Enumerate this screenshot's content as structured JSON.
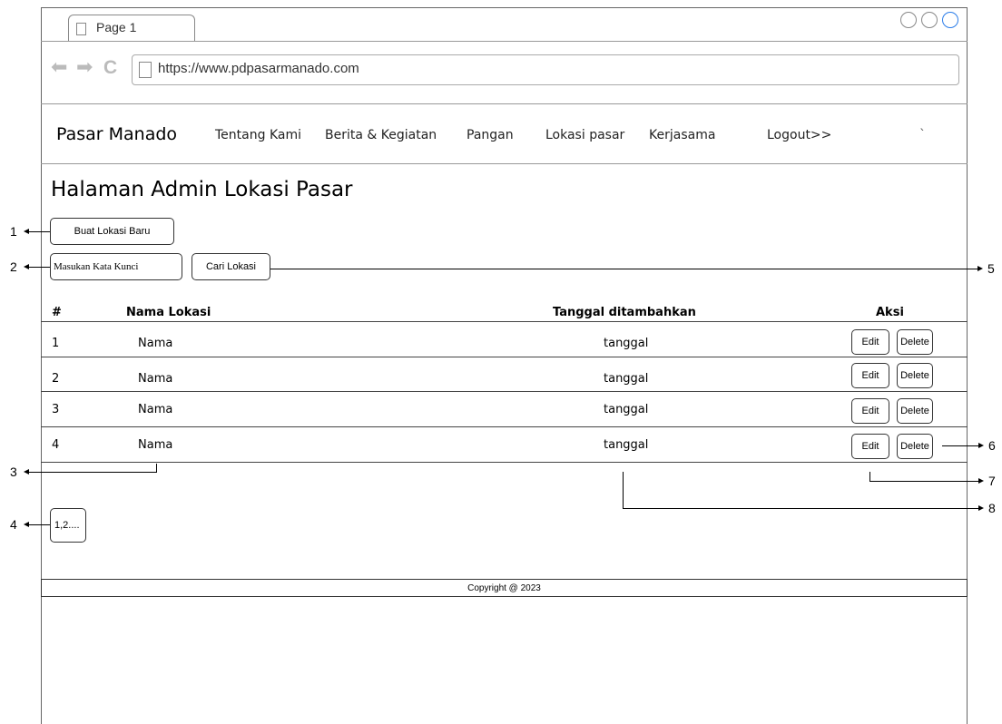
{
  "browser": {
    "tab_label": "Page 1",
    "url": "https://www.pdpasarmanado.com",
    "back_glyph": "⬅",
    "forward_glyph": "➡",
    "reload_glyph": "C"
  },
  "nav": {
    "brand": "Pasar Manado",
    "items": [
      "Tentang Kami",
      "Berita & Kegiatan",
      "Pangan",
      "Lokasi pasar",
      "Kerjasama",
      "Logout>>"
    ],
    "extra": "`"
  },
  "page": {
    "title": "Halaman Admin Lokasi Pasar",
    "create_button": "Buat Lokasi Baru",
    "search_placeholder": "Masukan Kata Kunci",
    "search_button": "Cari Lokasi"
  },
  "table": {
    "headers": [
      "#",
      "Nama Lokasi",
      "Tanggal ditambahkan",
      "Aksi"
    ],
    "rows": [
      {
        "no": "1",
        "name": "Nama",
        "date": "tanggal",
        "edit": "Edit",
        "delete": "Delete"
      },
      {
        "no": "2",
        "name": "Nama",
        "date": "tanggal",
        "edit": "Edit",
        "delete": "Delete"
      },
      {
        "no": "3",
        "name": "Nama",
        "date": "tanggal",
        "edit": "Edit",
        "delete": "Delete"
      },
      {
        "no": "4",
        "name": "Nama",
        "date": "tanggal",
        "edit": "Edit",
        "delete": "Delete"
      }
    ]
  },
  "pagination": {
    "label": "1,2...."
  },
  "footer": {
    "copyright": "Copyright @ 2023"
  },
  "annotations": [
    "1",
    "2",
    "3",
    "4",
    "5",
    "6",
    "7",
    "8"
  ],
  "colors": {
    "window_button_accent": "#2b7de9",
    "arrow_gray": "#bbbbbb"
  }
}
